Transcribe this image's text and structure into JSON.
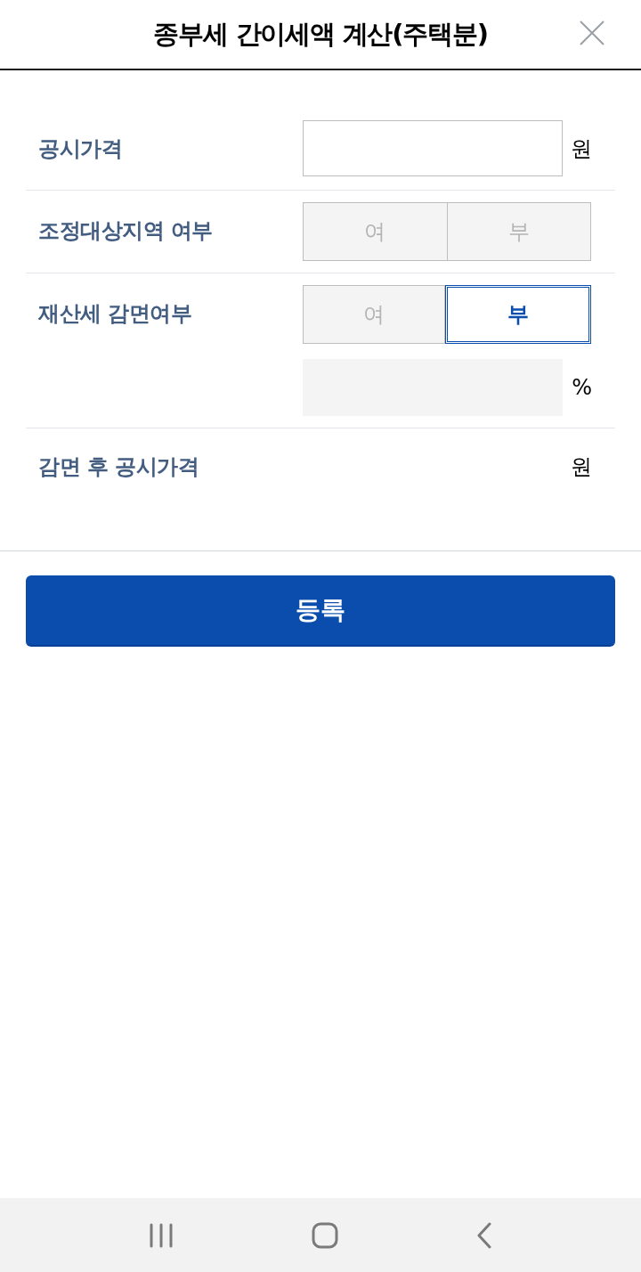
{
  "header": {
    "title": "종부세 간이세액 계산(주택분)"
  },
  "fields": [
    {
      "kind": "input",
      "label": "공시가격",
      "unit": "원",
      "disabled": false
    },
    {
      "kind": "toggle",
      "label": "조정대상지역 여부",
      "options": [
        {
          "label": "여",
          "selected": false
        },
        {
          "label": "부",
          "selected": false
        }
      ]
    },
    {
      "kind": "toggle",
      "label": "재산세 감면여부",
      "options": [
        {
          "label": "여",
          "selected": false
        },
        {
          "label": "부",
          "selected": true
        }
      ],
      "rate": {
        "unit": "%",
        "disabled": true
      }
    },
    {
      "kind": "result",
      "label": "감면 후 공시가격",
      "unit": "원"
    }
  ],
  "submit": {
    "label": "등록"
  }
}
